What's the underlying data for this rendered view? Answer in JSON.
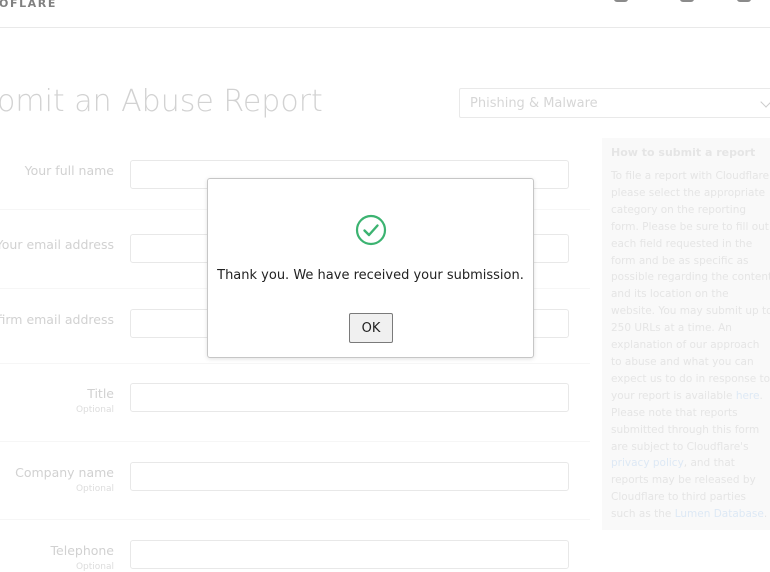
{
  "header": {
    "logo_text": "OFLARE"
  },
  "page": {
    "title": "omit an Abuse Report",
    "category_select": {
      "value": "Phishing & Malware"
    }
  },
  "form": {
    "fields": [
      {
        "label": "Your full name",
        "optional": ""
      },
      {
        "label": "Your email address",
        "optional": ""
      },
      {
        "label": "nfirm email address",
        "optional": ""
      },
      {
        "label": "Title",
        "optional": "Optional"
      },
      {
        "label": "Company name",
        "optional": "Optional"
      },
      {
        "label": "Telephone",
        "optional": "Optional"
      }
    ]
  },
  "help": {
    "title": "How to submit a report",
    "body_1": "To file a report with Cloudflare, please select the appropriate category on the reporting form. Please be sure to fill out each field requested in the form and be as specific as possible regarding the content and its location on the website. You may submit up to 250 URLs at a time. An explanation of our approach to abuse and what you can expect us to do in response to your report is available ",
    "link_here": "here",
    "body_2": ". Please note that reports submitted through this form are subject to Cloudflare's ",
    "link_privacy": "privacy policy",
    "body_3": ", and that reports may be released by Cloudflare to third parties such as the ",
    "link_lumen": "Lumen Database",
    "body_4": "."
  },
  "dialog": {
    "icon": "check-circle-icon",
    "message": "Thank you. We have received your submission.",
    "ok_label": "OK"
  },
  "colors": {
    "success_green": "#3cb371",
    "link_blue": "#c9dbef"
  }
}
